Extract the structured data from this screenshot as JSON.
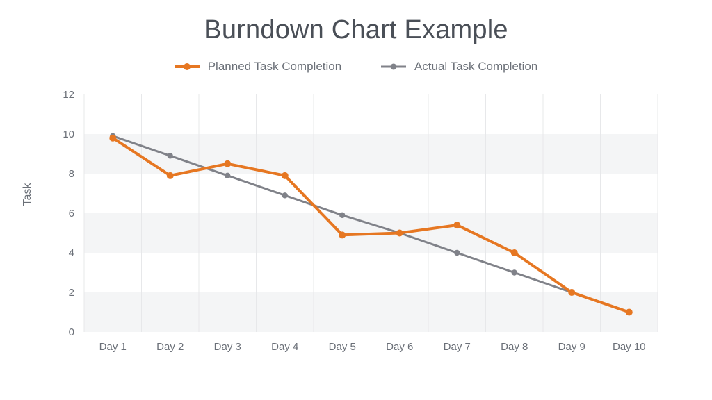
{
  "title": "Burndown Chart Example",
  "ylabel": "Task",
  "legend": {
    "planned": "Planned Task Completion",
    "actual": "Actual Task Completion"
  },
  "colors": {
    "planned": "#e67722",
    "actual": "#808289",
    "marker_fill": "#ffffff",
    "band": "#f4f5f6",
    "vline": "#e7e8ea",
    "text": "#6b7078"
  },
  "chart_data": {
    "type": "line",
    "title": "Burndown Chart Example",
    "xlabel": "",
    "ylabel": "Task",
    "ylim": [
      0,
      12
    ],
    "yticks": [
      0,
      2,
      4,
      6,
      8,
      10,
      12
    ],
    "categories": [
      "Day 1",
      "Day 2",
      "Day 3",
      "Day 4",
      "Day 5",
      "Day 6",
      "Day 7",
      "Day 8",
      "Day 9",
      "Day 10"
    ],
    "series": [
      {
        "name": "Planned Task Completion",
        "color": "#e67722",
        "values": [
          9.8,
          7.9,
          8.5,
          7.9,
          4.9,
          5.0,
          5.4,
          4.0,
          2.0,
          1.0
        ]
      },
      {
        "name": "Actual Task Completion",
        "color": "#808289",
        "values": [
          9.9,
          8.9,
          7.9,
          6.9,
          5.9,
          5.0,
          4.0,
          3.0,
          2.0
        ]
      }
    ],
    "legend_position": "top",
    "grid": true
  }
}
